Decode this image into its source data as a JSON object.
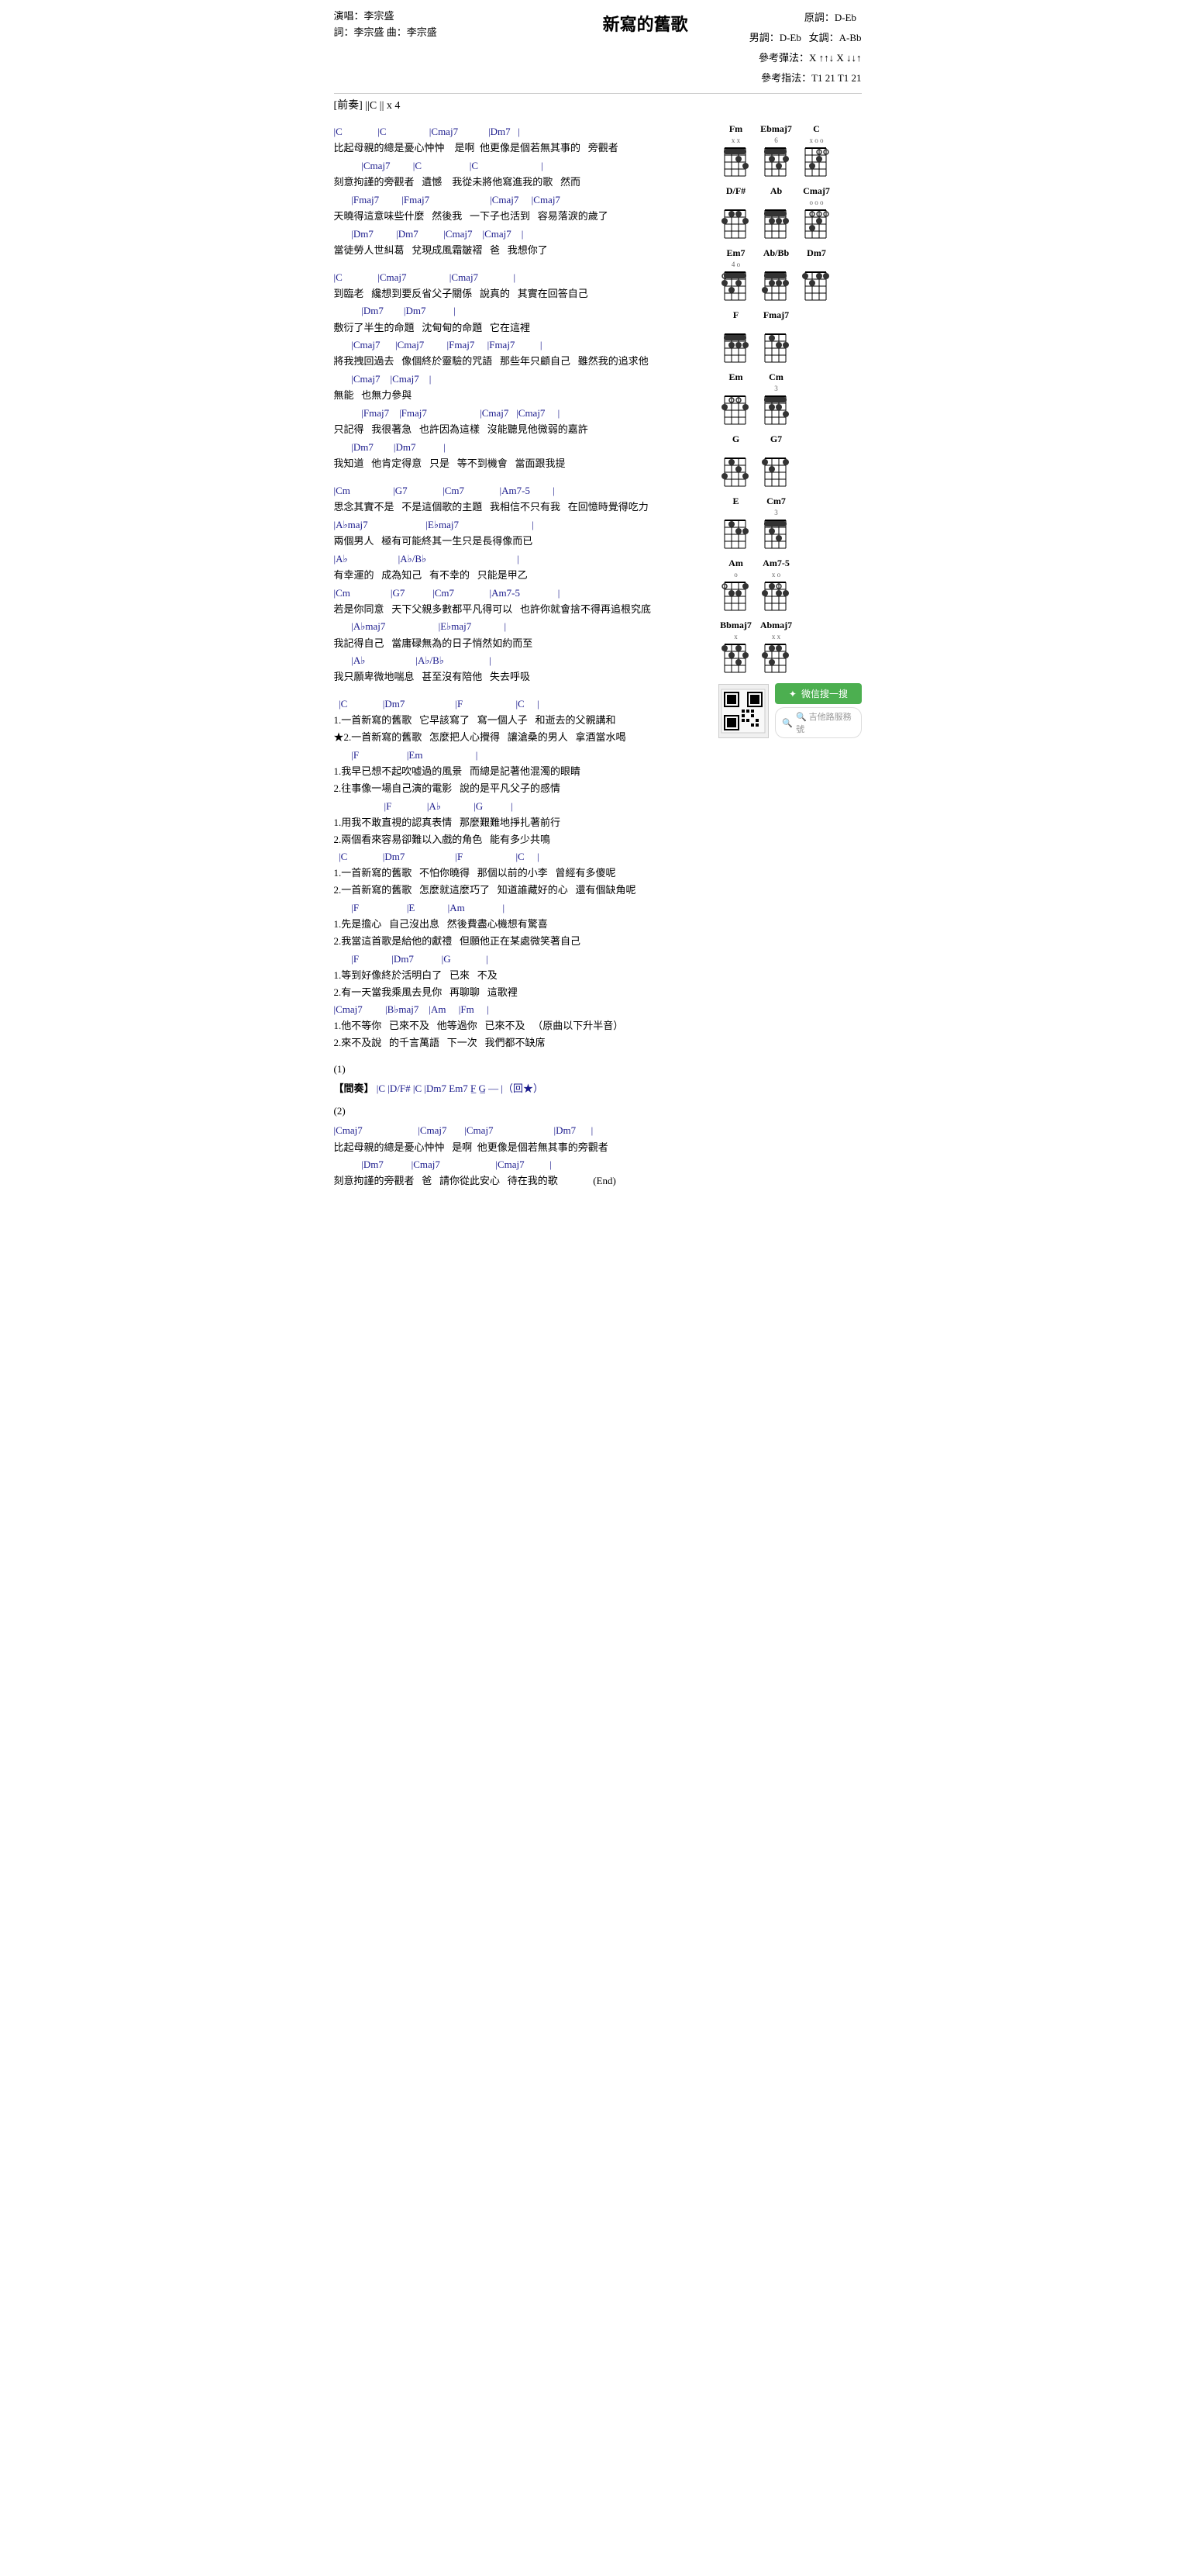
{
  "title": "新寫的舊歌",
  "singer": "演唱：李宗盛",
  "writer": "詞：李宗盛  曲：李宗盛",
  "original_key": "原調：D-Eb",
  "male_key": "男調：D-Eb",
  "female_key": "女調：A-Bb",
  "ref_method_label": "參考彈法：",
  "ref_method_value": "X ↑↑↓ X ↓↓↑",
  "ref_finger_label": "參考指法：",
  "ref_finger_value": "T1 21 T1 21",
  "prelude": "[前奏] ||C    || x 4",
  "lyrics": {
    "verse1_chords1": "|C              |C                 |Cmaj7            |Dm7   |",
    "verse1_line1": "比起母親的總是憂心忡忡    是啊  他更像是個若無其事的   旁觀者",
    "verse1_chords2": "           |Cmaj7         |C                   |C                         |",
    "verse1_line2": "刻意拘謹的旁觀者   遺憾    我從未將他寫進我的歌   然而",
    "verse1_chords3": "       |Fmaj7         |Fmaj7                        |Cmaj7     |Cmaj7",
    "verse1_line3": "天曉得這意味些什麼   然後我   一下子也活到   容易落淚的歲了",
    "verse1_chords4": "       |Dm7         |Dm7          |Cmaj7    |Cmaj7    |",
    "verse1_line4": "當徒勞人世糾葛   兌現成風霜皺褶   爸   我想你了",
    "verse2_chords1": "|C              |Cmaj7                 |Cmaj7              |",
    "verse2_line1": "到臨老   纔想到要反省父子關係   說真的   其實在回答自己",
    "verse2_chords2": "           |Dm7        |Dm7           |",
    "verse2_line2": "敷衍了半生的命題   沈甸甸的命題   它在這裡",
    "verse2_chords3": "       |Cmaj7      |Cmaj7         |Fmaj7     |Fmaj7          |",
    "verse2_line3": "將我拽回過去   像個終於靈驗的咒語   那些年只顧自己   雖然我的追求他",
    "verse2_chords4": "       |Cmaj7    |Cmaj7    |",
    "verse2_line4": "無能   也無力參與",
    "verse2_chords5": "           |Fmaj7    |Fmaj7                     |Cmaj7   |Cmaj7     |",
    "verse2_line5": "只記得   我很著急   也許因為這樣   沒能聽見他微弱的嘉許",
    "verse2_chords6": "       |Dm7        |Dm7           |",
    "verse2_line6": "我知道   他肯定得意   只是   等不到機會   當面跟我提",
    "chorus_chords1": "|Cm                 |G7              |Cm7              |Am7-5         |",
    "chorus_line1": "思念其實不是   不是這個歌的主題   我相信不只有我   在回憶時覺得吃力",
    "chorus_chords2": "|A♭maj7                       |E♭maj7                             |",
    "chorus_line2": "兩個男人   極有可能終其一生只是長得像而已",
    "chorus_chords3": "|A♭                    |A♭/B♭                                    |",
    "chorus_line3": "有幸運的   成為知己   有不幸的   只能是甲乙",
    "chorus_chords4": "|Cm                |G7           |Cm7              |Am7-5               |",
    "chorus_line4": "若是你同意   天下父親多數都平凡得可以   也許你就會捨不得再追根究底",
    "chorus_chords5": "       |A♭maj7                     |E♭maj7             |",
    "chorus_line5": "我記得自己   當庸碌無為的日子悄然如約而至",
    "chorus_chords6": "       |A♭                    |A♭/B♭                  |",
    "chorus_line6": "我只願卑微地喘息   甚至沒有陪他   失去呼吸",
    "song_chords1": "  |C              |Dm7                    |F                     |C     |",
    "song_line1": "1.一首新寫的舊歌   它早該寫了   寫一個人子   和逝去的父親講和",
    "song_line1b": "★2.一首新寫的舊歌   怎麼把人心攪得   讓滄桑的男人   拿酒當水喝",
    "song_chords2": "       |F                   |Em                     |",
    "song_line2": "1.我早已想不起吹嘘過的風景   而總是記著他混濁的眼睛",
    "song_line2b": "2.往事像一場自己演的電影   說的是平凡父子的感情",
    "song_chords3": "                    |F              |A♭             |G           |",
    "song_line3": "1.用我不敢直視的認真表情   那麼艱難地掙扎著前行",
    "song_line3b": "2.兩個看來容易卻難以入戲的角色   能有多少共鳴",
    "song_chords4": "  |C              |Dm7                    |F                     |C     |",
    "song_line4": "1.一首新寫的舊歌   不怕你曉得   那個以前的小李   曾經有多傻呢",
    "song_line4b": "2.一首新寫的舊歌   怎麼就這麼巧了   知道誰藏好的心   還有個缺角呢",
    "song_chords5": "       |F                   |E             |Am               |",
    "song_line5": "1.先是擔心   自己沒出息   然後費盡心機想有驚喜",
    "song_line5b": "2.我當這首歌是給他的獻禮   但願他正在某處微笑著自己",
    "song_chords6": "       |F             |Dm7           |G              |",
    "song_line6": "1.等到好像終於活明白了   已來   不及",
    "song_line6b": "2.有一天當我乘風去見你   再聊聊   這歌裡",
    "song_chords7": "|Cmaj7         |B♭maj7    |Am     |Fm     |",
    "song_line7": "1.他不等你   已來不及   他等過你   已來不及   （原曲以下升半音）",
    "song_line7b": "2.來不及說   的千言萬語   下一次   我們都不缺席",
    "coda1": "(1)",
    "interlude_label": "【間奏】",
    "interlude_chords": "|C   |D/F#   |C   |Dm7  Em7  F̲  G̲  —  |（回★）",
    "coda2": "(2)",
    "verse3_chords1": "|Cmaj7                      |Cmaj7       |Cmaj7                        |Dm7      |",
    "verse3_line1": "比起母親的總是憂心忡忡   是啊  他更像是個若無其事的旁觀者",
    "verse3_chords2": "           |Dm7           |Cmaj7                      |Cmaj7          |",
    "verse3_line2": "刻意拘謹的旁觀者   爸   請你從此安心   待在我的歌              (End)"
  },
  "chords": {
    "row1": [
      {
        "name": "Fm",
        "fret": "",
        "indicators": "x x",
        "grid": [
          [
            false,
            false,
            false,
            false,
            false
          ],
          [
            true,
            true,
            true,
            true,
            false
          ],
          [
            false,
            false,
            false,
            false,
            false
          ],
          [
            false,
            false,
            false,
            false,
            false
          ]
        ]
      },
      {
        "name": "Ebmaj7",
        "fret": "6",
        "indicators": "",
        "grid": [
          [
            false,
            true,
            false,
            false,
            false
          ],
          [
            false,
            true,
            false,
            true,
            false
          ],
          [
            false,
            false,
            true,
            false,
            false
          ],
          [
            false,
            false,
            false,
            false,
            false
          ]
        ]
      },
      {
        "name": "C",
        "fret": "",
        "indicators": "x o o",
        "grid": [
          [
            false,
            false,
            false,
            false,
            false
          ],
          [
            false,
            false,
            true,
            false,
            false
          ],
          [
            false,
            true,
            false,
            false,
            false
          ],
          [
            false,
            false,
            false,
            false,
            false
          ]
        ]
      }
    ],
    "row2": [
      {
        "name": "D/F#",
        "fret": "",
        "indicators": "",
        "grid": []
      },
      {
        "name": "Ab",
        "fret": "",
        "indicators": "",
        "grid": []
      },
      {
        "name": "Cmaj7",
        "fret": "",
        "indicators": "o o o",
        "grid": []
      }
    ],
    "row3": [
      {
        "name": "Em7",
        "fret": "4",
        "indicators": "o",
        "grid": []
      },
      {
        "name": "Ab/Bb",
        "fret": "",
        "indicators": "",
        "grid": []
      },
      {
        "name": "Dm7",
        "fret": "",
        "indicators": "",
        "grid": []
      }
    ],
    "row4": [
      {
        "name": "F",
        "fret": "",
        "indicators": "",
        "grid": []
      },
      {
        "name": "Fmaj7",
        "fret": "",
        "indicators": "",
        "grid": []
      }
    ],
    "row5": [
      {
        "name": "Em",
        "fret": "",
        "indicators": "",
        "grid": []
      },
      {
        "name": "Cm",
        "fret": "3",
        "indicators": "",
        "grid": []
      }
    ],
    "row6": [
      {
        "name": "G",
        "fret": "",
        "indicators": "",
        "grid": []
      },
      {
        "name": "G7",
        "fret": "",
        "indicators": "",
        "grid": []
      }
    ],
    "row7": [
      {
        "name": "E",
        "fret": "",
        "indicators": "",
        "grid": []
      },
      {
        "name": "Cm7",
        "fret": "3",
        "indicators": "",
        "grid": []
      }
    ],
    "row8": [
      {
        "name": "Am",
        "fret": "",
        "indicators": "o",
        "grid": []
      },
      {
        "name": "Am7-5",
        "fret": "",
        "indicators": "x o",
        "grid": []
      }
    ],
    "row9": [
      {
        "name": "Bbmaj7",
        "fret": "",
        "indicators": "x",
        "grid": []
      },
      {
        "name": "Abmaj7",
        "fret": "",
        "indicators": "x x",
        "grid": []
      }
    ]
  },
  "wechat": {
    "label": "微信搜一搜",
    "placeholder": "🔍 吉他路服務號"
  }
}
